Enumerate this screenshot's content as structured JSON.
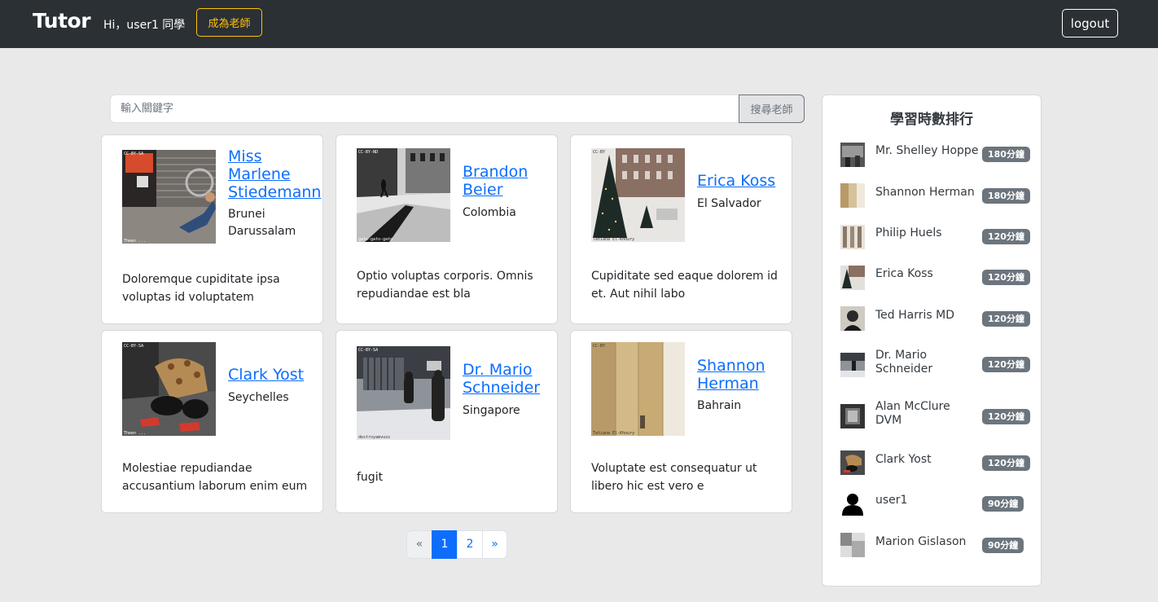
{
  "nav": {
    "brand": "Tutor",
    "greeting": "Hi，user1 同學",
    "become_teacher": "成為老師",
    "logout": "logout"
  },
  "search": {
    "placeholder": "輸入關鍵字",
    "button": "搜尋老師"
  },
  "teachers": [
    {
      "name": "Miss Marlene Stiedemann",
      "country": "Brunei Darussalam",
      "description": "Doloremque cupiditate ipsa voluptas id voluptatem"
    },
    {
      "name": "Brandon Beier",
      "country": "Colombia",
      "description": "Optio voluptas corporis. Omnis repudiandae est bla"
    },
    {
      "name": "Erica Koss",
      "country": "El Salvador",
      "description": "Cupiditate sed eaque dolorem id et. Aut nihil labo"
    },
    {
      "name": "Clark Yost",
      "country": "Seychelles",
      "description": "Molestiae repudiandae accusantium laborum enim eum"
    },
    {
      "name": "Dr. Mario Schneider",
      "country": "Singapore",
      "description": "fugit"
    },
    {
      "name": "Shannon Herman",
      "country": "Bahrain",
      "description": "Voluptate est consequatur ut libero hic est vero e"
    }
  ],
  "pagination": {
    "prev": "«",
    "pages": [
      "1",
      "2"
    ],
    "next": "»",
    "current": "1"
  },
  "ranking": {
    "title": "學習時數排行",
    "items": [
      {
        "name": "Mr. Shelley Hoppe",
        "minutes": "180分鐘"
      },
      {
        "name": "Shannon Herman",
        "minutes": "180分鐘"
      },
      {
        "name": "Philip Huels",
        "minutes": "120分鐘"
      },
      {
        "name": "Erica Koss",
        "minutes": "120分鐘"
      },
      {
        "name": "Ted Harris MD",
        "minutes": "120分鐘"
      },
      {
        "name": "Dr. Mario Schneider",
        "minutes": "120分鐘"
      },
      {
        "name": "Alan McClure DVM",
        "minutes": "120分鐘"
      },
      {
        "name": "Clark Yost",
        "minutes": "120分鐘"
      },
      {
        "name": "user1",
        "minutes": "90分鐘"
      },
      {
        "name": "Marion Gislason",
        "minutes": "90分鐘"
      }
    ]
  },
  "colors": {
    "navbar": "#2b3035",
    "accent_yellow": "#ffc107",
    "link_blue": "#0d6efd",
    "badge_gray": "#6c757d"
  }
}
